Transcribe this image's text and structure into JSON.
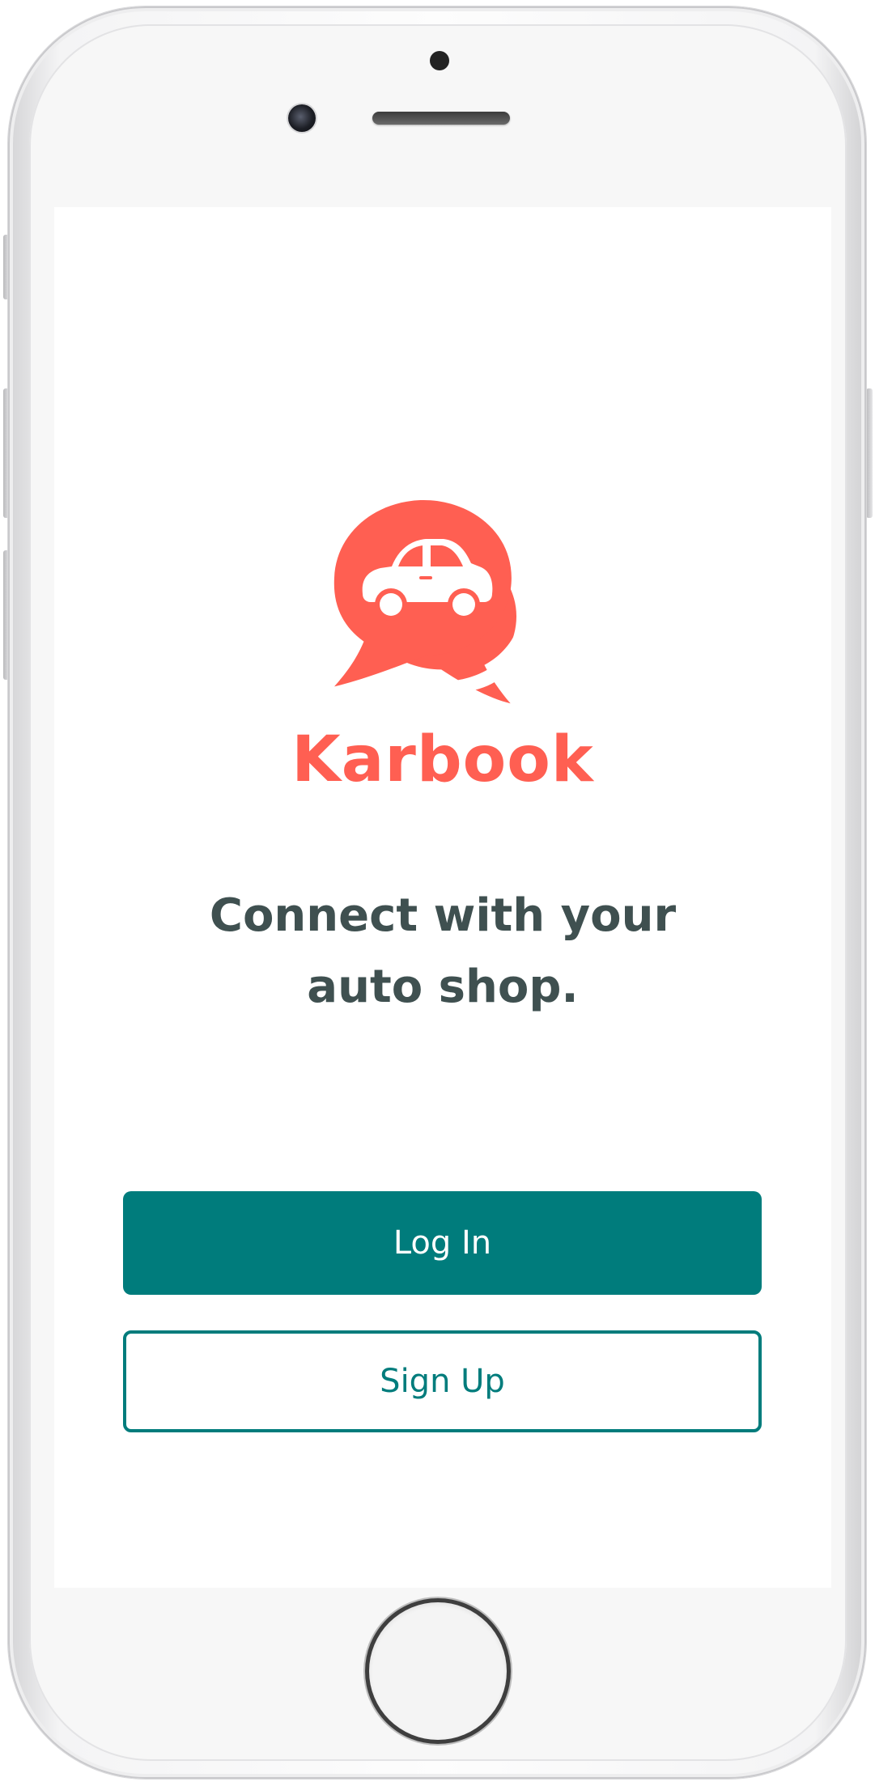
{
  "app": {
    "brand_name": "Karbook",
    "brand_color": "#ff5f52",
    "accent_color": "#007c7c",
    "text_color": "#3f5050"
  },
  "welcome": {
    "tagline_line1": "Connect with your",
    "tagline_line2": "auto shop."
  },
  "actions": {
    "login_label": "Log In",
    "signup_label": "Sign Up"
  },
  "icons": {
    "logo": "chat-bubbles-car-icon",
    "camera": "front-camera-icon",
    "speaker": "earpiece-speaker-icon",
    "home": "home-button-icon"
  }
}
